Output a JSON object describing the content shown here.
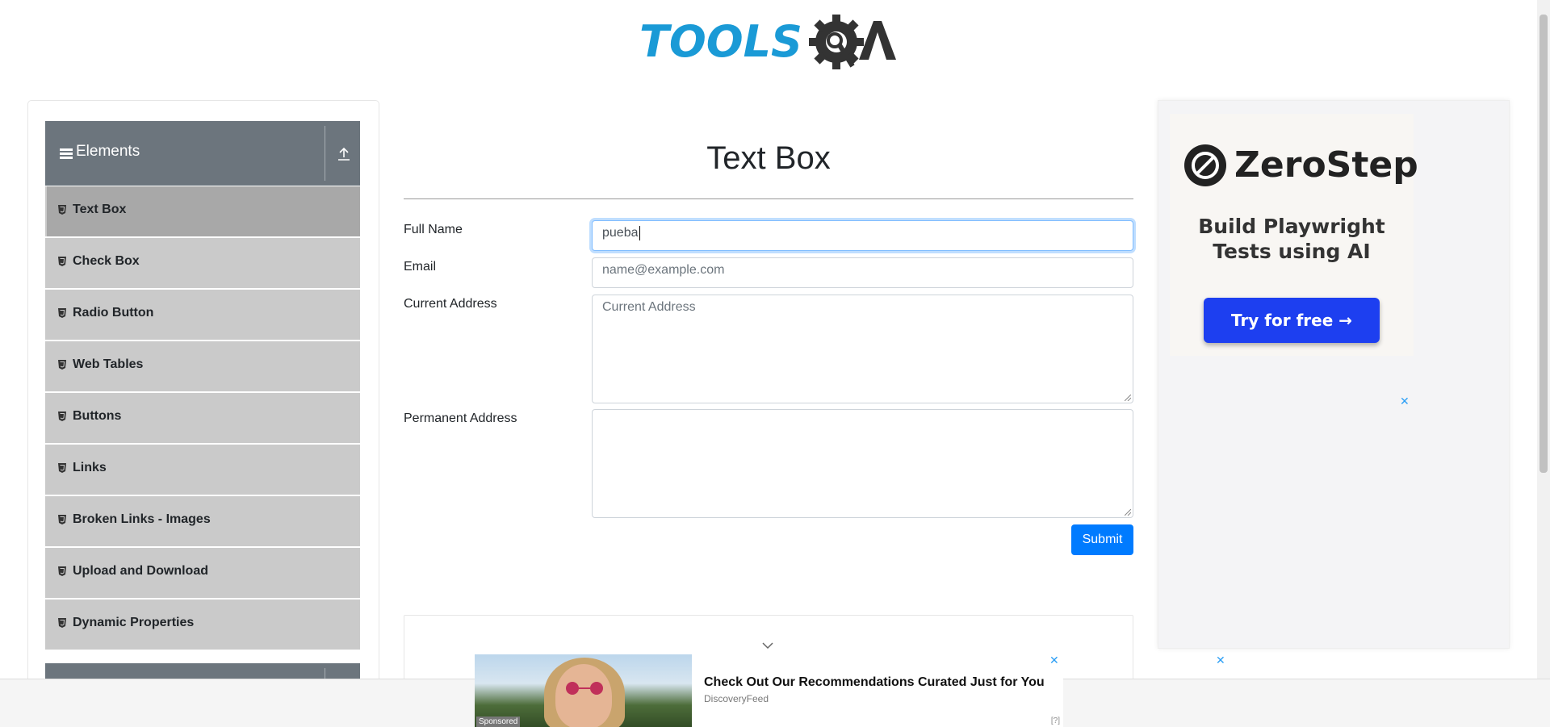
{
  "header": {
    "logo_text": "TOOLSQA"
  },
  "sidebar": {
    "group_title": "Elements",
    "items": [
      {
        "label": "Text Box"
      },
      {
        "label": "Check Box"
      },
      {
        "label": "Radio Button"
      },
      {
        "label": "Web Tables"
      },
      {
        "label": "Buttons"
      },
      {
        "label": "Links"
      },
      {
        "label": "Broken Links - Images"
      },
      {
        "label": "Upload and Download"
      },
      {
        "label": "Dynamic Properties"
      }
    ]
  },
  "form": {
    "title": "Text Box",
    "full_name_label": "Full Name",
    "full_name_value": "pueba",
    "email_label": "Email",
    "email_placeholder": "name@example.com",
    "current_address_label": "Current Address",
    "current_address_placeholder": "Current Address",
    "permanent_address_label": "Permanent Address",
    "submit_label": "Submit"
  },
  "ad_right": {
    "brand": "ZeroStep",
    "tagline": "Build Playwright Tests using AI",
    "cta": "Try for free →",
    "close_glyph": "✕"
  },
  "sticky_ad": {
    "title": "Check Out Our Recommendations Curated Just for You",
    "source": "DiscoveryFeed",
    "sponsored": "Sponsored",
    "meta": "[?]",
    "close_glyph": "✕"
  },
  "colors": {
    "accent": "#007bff",
    "sidebar_header": "#6c757d",
    "sidebar_item": "#cacaca",
    "sidebar_active": "#a8a8a8",
    "logo_blue": "#1a9ad6",
    "logo_dark": "#333333",
    "ad_cta": "#1d3ff0"
  }
}
